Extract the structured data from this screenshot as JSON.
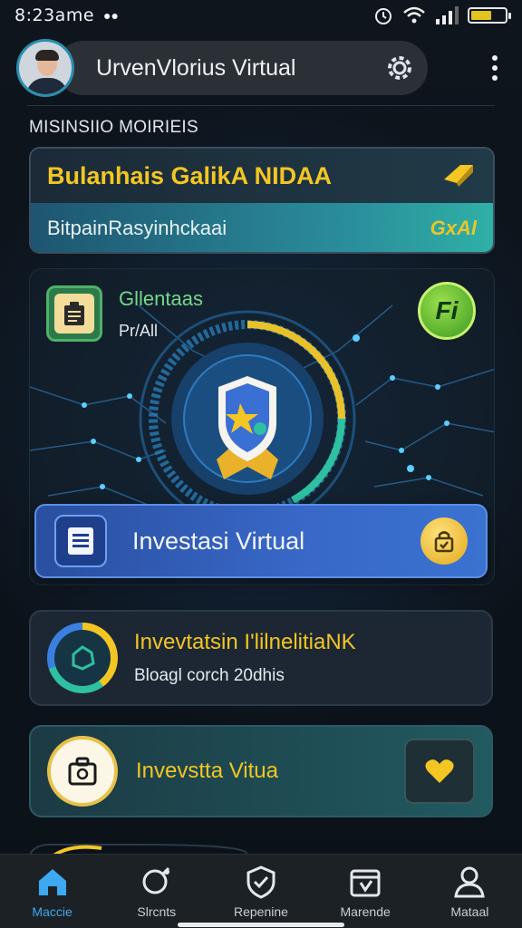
{
  "status_bar": {
    "time": "8:23",
    "time_suffix": "ame",
    "battery_color": "#e2c21c"
  },
  "header": {
    "title": "UrvenVlorius Virtual",
    "settings_icon": "gear-icon",
    "menu_icon": "kebab-icon"
  },
  "section_title": "MISINSIIO MOIRIEIS",
  "card1": {
    "title": "Bulanhais GalikA NIDAA",
    "subtitle": "BitpainRasyinhckaai",
    "value": "GxAl"
  },
  "hero": {
    "badge_label": "Gllentaas",
    "badge_sub": "Pr/All",
    "right_badge": "Fi"
  },
  "primary_button": {
    "label": "Investasi Virtual"
  },
  "card2": {
    "title": "Invevtatsin I'lilnelitiaNK",
    "subtitle": "Bloagl corch 20dhis"
  },
  "card3": {
    "title": "Invevstta Vitua"
  },
  "bottom_nav": [
    {
      "label": "Maccie",
      "icon": "home-icon",
      "active": true
    },
    {
      "label": "Slrcnts",
      "icon": "search-icon",
      "active": false
    },
    {
      "label": "Repenine",
      "icon": "shield-check-icon",
      "active": false
    },
    {
      "label": "Marende",
      "icon": "calendar-icon",
      "active": false
    },
    {
      "label": "Mataal",
      "icon": "user-icon",
      "active": false
    }
  ],
  "colors": {
    "accent_yellow": "#f3c624",
    "accent_blue": "#3ea8f0",
    "accent_green": "#74d88c"
  }
}
